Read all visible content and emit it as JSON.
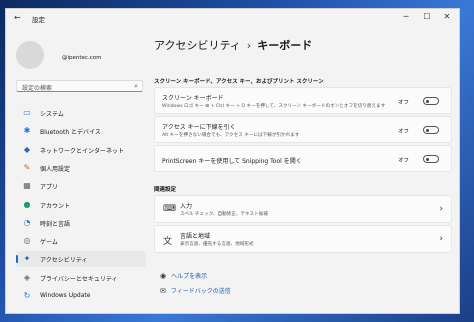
{
  "window": {
    "title": "設定",
    "back_icon": "←",
    "minimize": "─",
    "maximize": "☐",
    "close": "✕"
  },
  "account": {
    "email": "@ipentec.com"
  },
  "search": {
    "placeholder": "設定の検索"
  },
  "sidebar": {
    "items": [
      {
        "label": "システム",
        "icon": "system-icon",
        "color": "#2b7bd6",
        "glyph": "▭"
      },
      {
        "label": "Bluetooth とデバイス",
        "icon": "bluetooth-icon",
        "color": "#1f6fd1",
        "glyph": "✱"
      },
      {
        "label": "ネットワークとインターネット",
        "icon": "network-icon",
        "color": "#2c66c2",
        "glyph": "◆"
      },
      {
        "label": "個人用設定",
        "icon": "personalization-icon",
        "color": "#c2691f",
        "glyph": "✎"
      },
      {
        "label": "アプリ",
        "icon": "apps-icon",
        "color": "#5a5f6b",
        "glyph": "▦"
      },
      {
        "label": "アカウント",
        "icon": "account-icon",
        "color": "#1f9e6b",
        "glyph": "●"
      },
      {
        "label": "時刻と言語",
        "icon": "time-language-icon",
        "color": "#2a7bd0",
        "glyph": "◔"
      },
      {
        "label": "ゲーム",
        "icon": "gaming-icon",
        "color": "#5b6270",
        "glyph": "◎"
      },
      {
        "label": "アクセシビリティ",
        "icon": "accessibility-icon",
        "color": "#1a5fb4",
        "glyph": "✦"
      },
      {
        "label": "プライバシーとセキュリティ",
        "icon": "privacy-icon",
        "color": "#5f6675",
        "glyph": "◈"
      },
      {
        "label": "Windows Update",
        "icon": "windows-update-icon",
        "color": "#1c74cf",
        "glyph": "↻"
      }
    ],
    "active_index": 8
  },
  "breadcrumb": {
    "parent": "アクセシビリティ",
    "separator": "›",
    "current": "キーボード"
  },
  "sections": {
    "screen_keyboard": "スクリーン キーボード、アクセス キー、およびプリント スクリーン",
    "related": "関連設定"
  },
  "settings": [
    {
      "title": "スクリーン キーボード",
      "desc": "Windows ロゴ キー ⊞ + Ctrl キー + O キーを押して、スクリーン キーボードのオンとオフを切り替えます",
      "state": "オフ"
    },
    {
      "title": "アクセス キーに下線を引く",
      "desc": "Alt キーを押さない場合でも、アクセス キーには下線が引かれます",
      "state": "オフ"
    },
    {
      "title": "PrintScreen キーを使用して Snipping Tool を開く",
      "desc": "",
      "state": "オフ"
    }
  ],
  "related": [
    {
      "title": "入力",
      "desc": "スペル チェック、自動修正、テキスト候補",
      "icon": "keyboard-icon"
    },
    {
      "title": "言語と地域",
      "desc": "表示言語、優先する言語、地域形式",
      "icon": "language-icon"
    }
  ],
  "links": {
    "help": "ヘルプを表示",
    "feedback": "フィードバックの送信"
  },
  "colors": {
    "accent": "#1a5fb4",
    "window_bg": "#f3f3f3",
    "card_bg": "#fbfbfb"
  }
}
